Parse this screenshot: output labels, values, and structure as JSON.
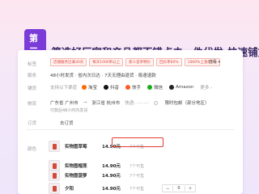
{
  "banner": {
    "step": "第三步:",
    "text": "筛选好厂家和产品都不错点击一件代发-快速铺货"
  },
  "card": {
    "tags_label": "标签",
    "tags": [
      "店铺服务已满30天",
      "每天1000单以上",
      "新人首单特价",
      "回头率60%",
      "1000%上涨8.0%"
    ],
    "more": "查看 ▾",
    "service_label": "服务",
    "service_text": "48小时发货 · 省内次日达 · 7天无理由退货 · 极速退款",
    "channel_label": "铺货",
    "channel_prefix": "支持以下渠道",
    "platforms": [
      {
        "name": "淘宝",
        "color": "#ff6a00"
      },
      {
        "name": "抖音",
        "color": "#111111"
      },
      {
        "name": "快手",
        "color": "#ff5a1f"
      },
      {
        "name": "微信",
        "color": "#1aad19"
      },
      {
        "name": "Amazon",
        "color": "#222222"
      }
    ],
    "platforms_more": "更多 ›",
    "ship_label": "物流",
    "ship_from": "广东省 广州市",
    "ship_to": "浙江省 杭州市",
    "ship_fee": "快递: ·········",
    "ship_note": "限时包邮（部分地区）",
    "ship_sub": "付款后48小时内发货",
    "order_label": "订货",
    "order_value": "去订货",
    "color_label": "颜色",
    "skus": [
      {
        "name": "实物图草莓",
        "price": "14.90元",
        "stock": "7个可售",
        "qty": "0"
      },
      {
        "name": "实物图榴莲",
        "price": "14.90元",
        "stock": "7个可售",
        "qty": "0"
      },
      {
        "name": "实物图菠萝",
        "price": "14.90元",
        "stock": "7个可售",
        "qty": "0"
      },
      {
        "name": "夕阳",
        "price": "14.90元",
        "stock": "7个可售",
        "qty": "0"
      }
    ]
  }
}
